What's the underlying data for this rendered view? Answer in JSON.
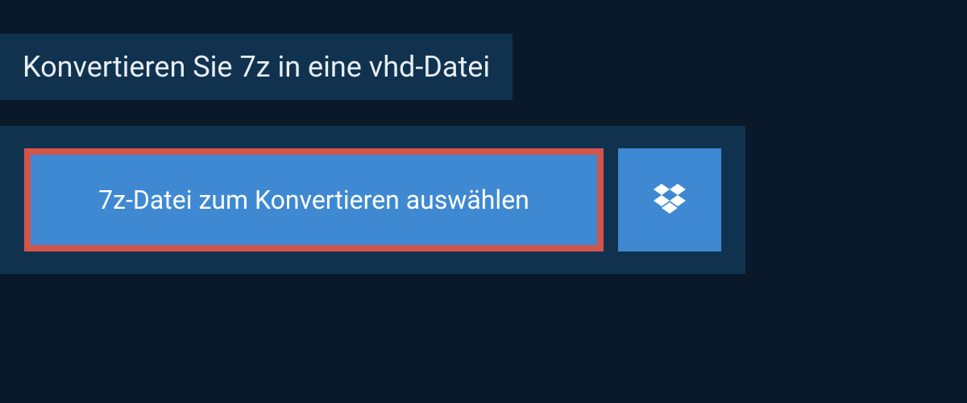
{
  "header": {
    "title": "Konvertieren Sie 7z in eine vhd-Datei"
  },
  "uploader": {
    "select_button_label": "7z-Datei zum Konvertieren auswählen"
  },
  "colors": {
    "background": "#0a1929",
    "panel": "#11324f",
    "button": "#3e89d2",
    "highlight_border": "#d2544a",
    "text_light": "#e8eef3"
  }
}
